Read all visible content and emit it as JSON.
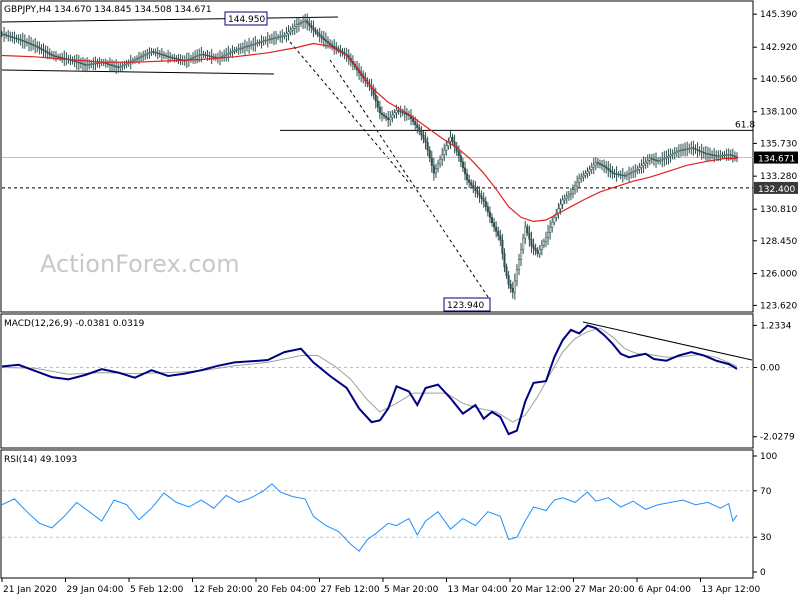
{
  "colors": {
    "background": "#ffffff",
    "candle": "#2f4f4f",
    "ema": "#e02020",
    "macd_line": "#000080",
    "macd_signal": "#a0a0a0",
    "rsi_line": "#1e90ff",
    "grid": "#c0c0c0",
    "trendline": "#000000",
    "price_tag_bg": "#000000",
    "price_tag_fg": "#ffffff"
  },
  "watermark": "ActionForex.com",
  "chart_data": [
    {
      "type": "candlestick",
      "title": "GBPJPY,H4  134.670 134.845 134.508 134.671",
      "y_ticks": [
        "145.390",
        "142.920",
        "140.560",
        "138.100",
        "135.730",
        "133.280",
        "130.810",
        "128.450",
        "126.000",
        "123.620"
      ],
      "ylim": [
        123.2,
        146.3
      ],
      "last_price": "134.671",
      "support_level": "132.400",
      "fib_label": "61.8",
      "fib_level": 136.7,
      "high_label": "144.950",
      "low_label": "123.940",
      "x_ticks": [
        "21 Jan 2020",
        "29 Jan 04:00",
        "5 Feb 12:00",
        "12 Feb 20:00",
        "20 Feb 04:00",
        "27 Feb 12:00",
        "5 Mar 20:00",
        "13 Mar 04:00",
        "20 Mar 12:00",
        "27 Mar 20:00",
        "6 Apr 04:00",
        "13 Apr 12:00"
      ],
      "close_path": [
        [
          0,
          143.9
        ],
        [
          8,
          143.5
        ],
        [
          16,
          143.0
        ],
        [
          24,
          142.3
        ],
        [
          32,
          142.0
        ],
        [
          40,
          141.6
        ],
        [
          48,
          141.8
        ],
        [
          56,
          141.4
        ],
        [
          64,
          142.0
        ],
        [
          72,
          142.6
        ],
        [
          80,
          142.2
        ],
        [
          88,
          141.9
        ],
        [
          96,
          142.4
        ],
        [
          104,
          142.1
        ],
        [
          112,
          142.7
        ],
        [
          120,
          143.1
        ],
        [
          128,
          143.5
        ],
        [
          136,
          143.8
        ],
        [
          142,
          144.6
        ],
        [
          146,
          144.9
        ],
        [
          150,
          144.2
        ],
        [
          154,
          143.6
        ],
        [
          158,
          143.1
        ],
        [
          166,
          142.3
        ],
        [
          172,
          141.0
        ],
        [
          178,
          139.8
        ],
        [
          182,
          138.0
        ],
        [
          186,
          137.5
        ],
        [
          190,
          138.2
        ],
        [
          196,
          137.8
        ],
        [
          200,
          136.9
        ],
        [
          204,
          135.8
        ],
        [
          208,
          133.5
        ],
        [
          212,
          134.9
        ],
        [
          216,
          136.2
        ],
        [
          220,
          134.8
        ],
        [
          224,
          133.0
        ],
        [
          228,
          132.2
        ],
        [
          232,
          131.4
        ],
        [
          236,
          129.8
        ],
        [
          240,
          128.5
        ],
        [
          242,
          126.5
        ],
        [
          244,
          125.2
        ],
        [
          246,
          124.6
        ],
        [
          248,
          126.3
        ],
        [
          250,
          127.8
        ],
        [
          252,
          129.5
        ],
        [
          255,
          128.1
        ],
        [
          258,
          127.5
        ],
        [
          262,
          128.7
        ],
        [
          266,
          130.2
        ],
        [
          270,
          131.5
        ],
        [
          274,
          132.0
        ],
        [
          278,
          133.1
        ],
        [
          282,
          133.6
        ],
        [
          286,
          134.3
        ],
        [
          290,
          134.0
        ],
        [
          294,
          133.5
        ],
        [
          300,
          133.3
        ],
        [
          306,
          133.8
        ],
        [
          312,
          134.6
        ],
        [
          316,
          134.4
        ],
        [
          320,
          134.7
        ],
        [
          326,
          135.2
        ],
        [
          332,
          135.4
        ],
        [
          338,
          135.0
        ],
        [
          344,
          134.8
        ],
        [
          350,
          134.9
        ],
        [
          354,
          134.67
        ]
      ],
      "ema": [
        [
          0,
          142.3
        ],
        [
          16,
          142.2
        ],
        [
          32,
          142.0
        ],
        [
          48,
          141.8
        ],
        [
          64,
          141.8
        ],
        [
          80,
          141.9
        ],
        [
          96,
          142.0
        ],
        [
          112,
          142.2
        ],
        [
          128,
          142.5
        ],
        [
          142,
          142.9
        ],
        [
          150,
          143.2
        ],
        [
          158,
          143.0
        ],
        [
          166,
          142.3
        ],
        [
          172,
          141.2
        ],
        [
          178,
          139.9
        ],
        [
          186,
          138.8
        ],
        [
          196,
          137.9
        ],
        [
          204,
          137.0
        ],
        [
          212,
          136.1
        ],
        [
          220,
          135.3
        ],
        [
          226,
          134.5
        ],
        [
          232,
          133.5
        ],
        [
          238,
          132.3
        ],
        [
          244,
          131.0
        ],
        [
          250,
          130.2
        ],
        [
          256,
          129.9
        ],
        [
          262,
          130.0
        ],
        [
          268,
          130.5
        ],
        [
          274,
          131.0
        ],
        [
          280,
          131.5
        ],
        [
          288,
          132.1
        ],
        [
          296,
          132.5
        ],
        [
          304,
          132.9
        ],
        [
          312,
          133.2
        ],
        [
          320,
          133.6
        ],
        [
          330,
          134.1
        ],
        [
          340,
          134.4
        ],
        [
          348,
          134.6
        ],
        [
          354,
          134.6
        ]
      ]
    },
    {
      "type": "line",
      "title": "MACD(12,26,9) -0.0381 0.0319",
      "y_ticks": [
        "1.2334",
        "0.00",
        "-2.0279"
      ],
      "ylim": [
        -2.3,
        1.45
      ],
      "zero_value": 0.0,
      "series": [
        {
          "name": "MACD",
          "values": [
            [
              0,
              0.03
            ],
            [
              8,
              0.08
            ],
            [
              16,
              -0.1
            ],
            [
              24,
              -0.28
            ],
            [
              32,
              -0.35
            ],
            [
              40,
              -0.22
            ],
            [
              48,
              -0.05
            ],
            [
              56,
              -0.15
            ],
            [
              64,
              -0.3
            ],
            [
              72,
              -0.08
            ],
            [
              80,
              -0.25
            ],
            [
              88,
              -0.18
            ],
            [
              96,
              -0.08
            ],
            [
              104,
              0.05
            ],
            [
              112,
              0.15
            ],
            [
              120,
              0.18
            ],
            [
              128,
              0.22
            ],
            [
              136,
              0.45
            ],
            [
              144,
              0.55
            ],
            [
              150,
              0.15
            ],
            [
              158,
              -0.25
            ],
            [
              166,
              -0.6
            ],
            [
              172,
              -1.2
            ],
            [
              178,
              -1.6
            ],
            [
              182,
              -1.55
            ],
            [
              186,
              -1.2
            ],
            [
              190,
              -0.55
            ],
            [
              196,
              -0.7
            ],
            [
              200,
              -1.1
            ],
            [
              204,
              -0.6
            ],
            [
              210,
              -0.5
            ],
            [
              216,
              -0.9
            ],
            [
              222,
              -1.35
            ],
            [
              228,
              -1.1
            ],
            [
              232,
              -1.5
            ],
            [
              236,
              -1.3
            ],
            [
              240,
              -1.45
            ],
            [
              244,
              -1.95
            ],
            [
              248,
              -1.85
            ],
            [
              252,
              -1.0
            ],
            [
              256,
              -0.45
            ],
            [
              262,
              -0.4
            ],
            [
              266,
              0.3
            ],
            [
              270,
              0.8
            ],
            [
              274,
              1.1
            ],
            [
              278,
              1.0
            ],
            [
              282,
              1.23
            ],
            [
              286,
              1.15
            ],
            [
              290,
              0.95
            ],
            [
              294,
              0.7
            ],
            [
              298,
              0.4
            ],
            [
              302,
              0.3
            ],
            [
              306,
              0.35
            ],
            [
              310,
              0.4
            ],
            [
              314,
              0.25
            ],
            [
              320,
              0.2
            ],
            [
              326,
              0.35
            ],
            [
              332,
              0.45
            ],
            [
              338,
              0.35
            ],
            [
              344,
              0.2
            ],
            [
              350,
              0.1
            ],
            [
              354,
              -0.04
            ]
          ]
        },
        {
          "name": "Signal",
          "values": [
            [
              0,
              0.0
            ],
            [
              16,
              -0.02
            ],
            [
              32,
              -0.2
            ],
            [
              48,
              -0.15
            ],
            [
              64,
              -0.18
            ],
            [
              80,
              -0.15
            ],
            [
              96,
              -0.1
            ],
            [
              112,
              0.05
            ],
            [
              128,
              0.15
            ],
            [
              144,
              0.35
            ],
            [
              152,
              0.35
            ],
            [
              160,
              0.05
            ],
            [
              168,
              -0.35
            ],
            [
              176,
              -0.95
            ],
            [
              182,
              -1.3
            ],
            [
              190,
              -1.05
            ],
            [
              198,
              -0.75
            ],
            [
              206,
              -0.75
            ],
            [
              214,
              -0.75
            ],
            [
              222,
              -1.05
            ],
            [
              230,
              -1.2
            ],
            [
              238,
              -1.3
            ],
            [
              246,
              -1.6
            ],
            [
              252,
              -1.4
            ],
            [
              258,
              -0.85
            ],
            [
              264,
              -0.2
            ],
            [
              270,
              0.45
            ],
            [
              276,
              0.85
            ],
            [
              282,
              1.05
            ],
            [
              288,
              1.15
            ],
            [
              294,
              0.9
            ],
            [
              300,
              0.55
            ],
            [
              306,
              0.4
            ],
            [
              312,
              0.38
            ],
            [
              320,
              0.3
            ],
            [
              328,
              0.32
            ],
            [
              336,
              0.38
            ],
            [
              344,
              0.3
            ],
            [
              350,
              0.15
            ],
            [
              354,
              0.03
            ]
          ]
        }
      ]
    },
    {
      "type": "line",
      "title": "RSI(14) 49.1093",
      "y_ticks": [
        "100",
        "70",
        "30",
        "0"
      ],
      "ylim": [
        0,
        100
      ],
      "levels": [
        70,
        30
      ],
      "series": [
        {
          "name": "RSI",
          "values": [
            [
              0,
              58
            ],
            [
              6,
              63
            ],
            [
              12,
              52
            ],
            [
              18,
              42
            ],
            [
              24,
              38
            ],
            [
              30,
              48
            ],
            [
              36,
              60
            ],
            [
              42,
              52
            ],
            [
              48,
              44
            ],
            [
              54,
              62
            ],
            [
              60,
              58
            ],
            [
              66,
              45
            ],
            [
              72,
              55
            ],
            [
              78,
              68
            ],
            [
              84,
              60
            ],
            [
              90,
              56
            ],
            [
              96,
              62
            ],
            [
              102,
              55
            ],
            [
              108,
              66
            ],
            [
              114,
              60
            ],
            [
              120,
              64
            ],
            [
              126,
              70
            ],
            [
              130,
              76
            ],
            [
              134,
              69
            ],
            [
              140,
              65
            ],
            [
              146,
              63
            ],
            [
              150,
              48
            ],
            [
              156,
              40
            ],
            [
              162,
              35
            ],
            [
              168,
              24
            ],
            [
              172,
              18
            ],
            [
              176,
              28
            ],
            [
              180,
              33
            ],
            [
              186,
              42
            ],
            [
              190,
              40
            ],
            [
              196,
              46
            ],
            [
              200,
              32
            ],
            [
              204,
              44
            ],
            [
              210,
              52
            ],
            [
              216,
              37
            ],
            [
              222,
              46
            ],
            [
              228,
              40
            ],
            [
              234,
              52
            ],
            [
              240,
              48
            ],
            [
              244,
              28
            ],
            [
              248,
              30
            ],
            [
              252,
              44
            ],
            [
              256,
              56
            ],
            [
              262,
              53
            ],
            [
              266,
              62
            ],
            [
              270,
              64
            ],
            [
              276,
              60
            ],
            [
              282,
              69
            ],
            [
              286,
              61
            ],
            [
              292,
              64
            ],
            [
              298,
              56
            ],
            [
              304,
              61
            ],
            [
              310,
              54
            ],
            [
              316,
              58
            ],
            [
              322,
              60
            ],
            [
              328,
              62
            ],
            [
              334,
              58
            ],
            [
              340,
              60
            ],
            [
              346,
              55
            ],
            [
              350,
              59
            ],
            [
              352,
              44
            ],
            [
              354,
              49
            ]
          ]
        }
      ]
    }
  ]
}
